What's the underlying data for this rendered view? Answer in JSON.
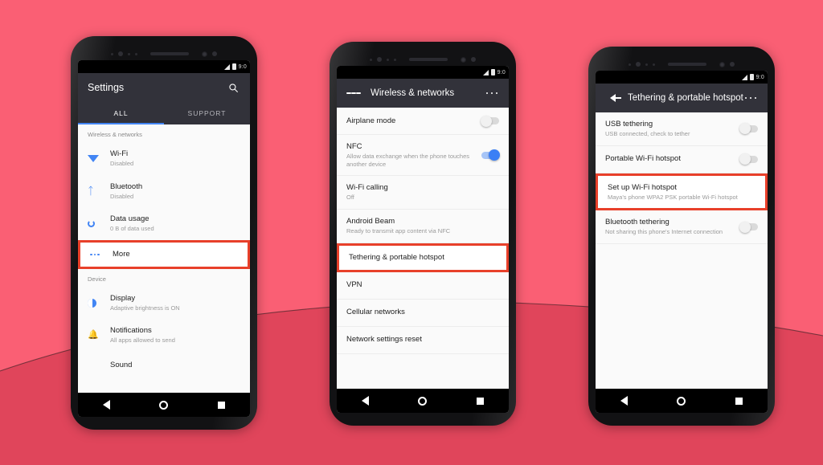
{
  "background": {
    "top_color": "#FA5F74",
    "bottom_color": "#E0455B"
  },
  "theme": {
    "accent_blue": "#4285F4",
    "highlight_red": "#E8402A",
    "appbar_dark": "#32323a",
    "screen_bg": "#fafafa"
  },
  "phones": [
    {
      "id": "phone-settings",
      "statusbar": {
        "clock": "9:0"
      },
      "appbar": {
        "title": "Settings",
        "search_icon": "search-icon"
      },
      "tabs": [
        {
          "label": "ALL",
          "active": true
        },
        {
          "label": "SUPPORT",
          "active": false
        }
      ],
      "sections": [
        {
          "header": "Wireless & networks",
          "rows": [
            {
              "icon": "wifi-icon",
              "title": "Wi-Fi",
              "subtitle": "Disabled",
              "highlight": false
            },
            {
              "icon": "bluetooth-icon",
              "title": "Bluetooth",
              "subtitle": "Disabled",
              "highlight": false
            },
            {
              "icon": "data-usage-icon",
              "title": "Data usage",
              "subtitle": "0 B of data used",
              "highlight": false
            },
            {
              "icon": "more-icon",
              "title": "More",
              "subtitle": "",
              "highlight": true
            }
          ]
        },
        {
          "header": "Device",
          "rows": [
            {
              "icon": "display-icon",
              "title": "Display",
              "subtitle": "Adaptive brightness is ON",
              "highlight": false
            },
            {
              "icon": "notifications-icon",
              "title": "Notifications",
              "subtitle": "All apps allowed to send",
              "highlight": false
            },
            {
              "icon": "sound-icon",
              "title": "Sound",
              "subtitle": "",
              "highlight": false
            }
          ]
        }
      ]
    },
    {
      "id": "phone-wireless",
      "statusbar": {
        "clock": "9:0"
      },
      "appbar": {
        "title": "Wireless & networks",
        "menu_icon": "hamburger-icon",
        "overflow_icon": "overflow-menu-icon"
      },
      "rows": [
        {
          "title": "Airplane mode",
          "subtitle": "",
          "toggle": "off",
          "highlight": false
        },
        {
          "title": "NFC",
          "subtitle": "Allow data exchange when the phone touches another device",
          "toggle": "on",
          "highlight": false
        },
        {
          "title": "Wi-Fi calling",
          "subtitle": "Off",
          "toggle": null,
          "highlight": false
        },
        {
          "title": "Android Beam",
          "subtitle": "Ready to transmit app content via NFC",
          "toggle": null,
          "highlight": false
        },
        {
          "title": "Tethering & portable hotspot",
          "subtitle": "",
          "toggle": null,
          "highlight": true
        },
        {
          "title": "VPN",
          "subtitle": "",
          "toggle": null,
          "highlight": false
        },
        {
          "title": "Cellular networks",
          "subtitle": "",
          "toggle": null,
          "highlight": false
        },
        {
          "title": "Network settings reset",
          "subtitle": "",
          "toggle": null,
          "highlight": false
        }
      ]
    },
    {
      "id": "phone-tethering",
      "statusbar": {
        "clock": "9:0"
      },
      "appbar": {
        "title": "Tethering & portable hotspot",
        "back_icon": "back-arrow-icon",
        "overflow_icon": "overflow-menu-icon"
      },
      "rows": [
        {
          "title": "USB tethering",
          "subtitle": "USB connected, check to tether",
          "toggle": "off",
          "highlight": false
        },
        {
          "title": "Portable Wi-Fi hotspot",
          "subtitle": "",
          "toggle": "off",
          "highlight": false
        },
        {
          "title": "Set up Wi-Fi hotspot",
          "subtitle": "Maya's phone WPA2 PSK portable Wi-Fi hotspot",
          "toggle": null,
          "highlight": true
        },
        {
          "title": "Bluetooth tethering",
          "subtitle": "Not sharing this phone's Internet connection",
          "toggle": "off",
          "highlight": false
        }
      ]
    }
  ],
  "navbar": {
    "back": "back-nav-icon",
    "home": "home-nav-icon",
    "recents": "recents-nav-icon"
  }
}
